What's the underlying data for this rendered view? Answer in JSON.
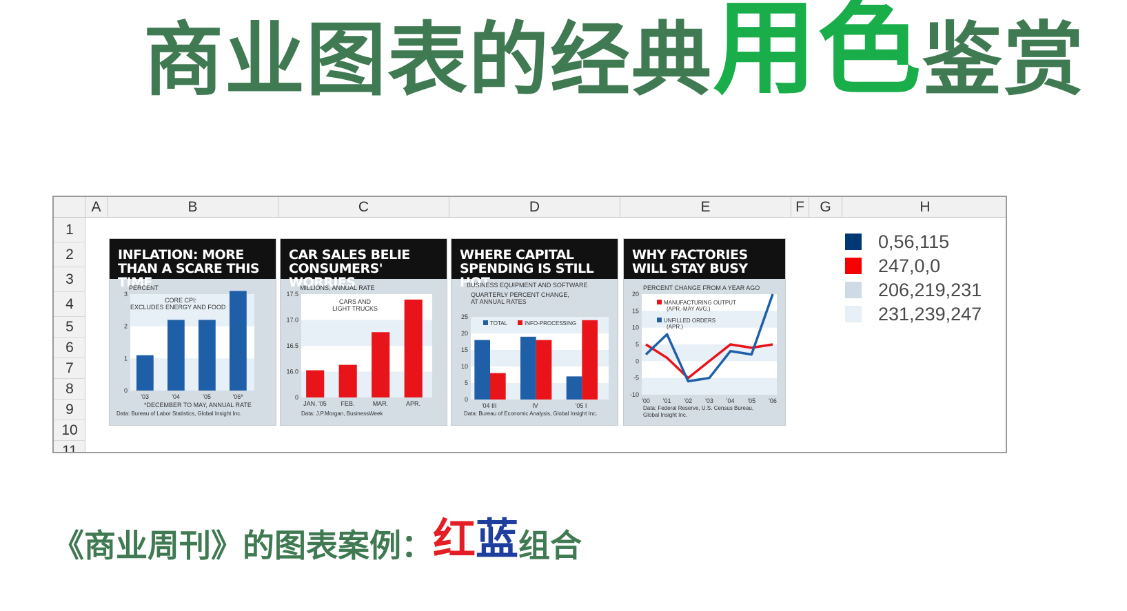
{
  "title": {
    "part1": "商业图表的经典",
    "part2": "用色",
    "part3": "鉴赏"
  },
  "sheet": {
    "columns": [
      "A",
      "B",
      "C",
      "D",
      "E",
      "F",
      "G",
      "H"
    ],
    "rows": [
      "1",
      "2",
      "3",
      "4",
      "5",
      "6",
      "7",
      "8",
      "9",
      "10",
      "11"
    ]
  },
  "charts": [
    {
      "headline": "INFLATION: MORE THAN A SCARE THIS TIME",
      "unit_label": "PERCENT",
      "note": "CORE CPI: EXCLUDES ENERGY AND FOOD",
      "footnote": "*DECEMBER TO MAY, ANNUAL RATE",
      "source": "Data: Bureau of Labor Statistics, Global Insight Inc.",
      "chart_data": {
        "type": "bar",
        "categories": [
          "'03",
          "'04",
          "'05",
          "'06*"
        ],
        "series": [
          {
            "values": [
              1.1,
              2.2,
              2.2,
              3.1
            ]
          }
        ],
        "ylim": [
          0,
          3
        ],
        "yticks": [
          "0",
          "1",
          "2",
          "3"
        ]
      }
    },
    {
      "headline": "CAR SALES BELIE CONSUMERS' WORRIES",
      "unit_label": "MILLIONS, ANNUAL RATE",
      "note": "CARS AND LIGHT TRUCKS",
      "source": "Data: J.P.Morgan, BusinessWeek",
      "chart_data": {
        "type": "bar",
        "categories": [
          "JAN. '05",
          "FEB.",
          "MAR.",
          "APR."
        ],
        "series": [
          {
            "values": [
              16.1,
              16.2,
              16.8,
              17.4
            ]
          }
        ],
        "ylim": [
          15.6,
          17.5
        ],
        "yticks": [
          "0",
          "16.0",
          "16.5",
          "17.0",
          "17.5"
        ]
      }
    },
    {
      "headline": "WHERE CAPITAL SPENDING IS STILL HOT",
      "subhead": "BUSINESS EQUIPMENT AND SOFTWARE",
      "unit_label": "QUARTERLY PERCENT CHANGE, AT ANNUAL RATES",
      "source": "Data: Bureau of Economic Analysis, Global Insight Inc.",
      "chart_data": {
        "type": "bar",
        "categories": [
          "'04 III",
          "IV",
          "'05 I"
        ],
        "series": [
          {
            "name": "TOTAL",
            "values": [
              18,
              19,
              7
            ]
          },
          {
            "name": "INFO-PROCESSING",
            "values": [
              8,
              18,
              24
            ]
          }
        ],
        "ylim": [
          0,
          25
        ],
        "yticks": [
          "0",
          "5",
          "10",
          "15",
          "20",
          "25"
        ]
      }
    },
    {
      "headline": "WHY FACTORIES WILL STAY BUSY",
      "unit_label": "PERCENT CHANGE FROM A YEAR AGO",
      "source": "Data: Federal Reserve, U.S. Census Bureau, Global Insight Inc.",
      "chart_data": {
        "type": "line",
        "x": [
          "'00",
          "'01",
          "'02",
          "'03",
          "'04",
          "'05",
          "'06"
        ],
        "series": [
          {
            "name": "MANUFACTURING OUTPUT (APR.-MAY AVG.)",
            "sub": "(APR.-MAY AVG.)",
            "values": [
              5,
              1,
              -5,
              0,
              5,
              4,
              5
            ]
          },
          {
            "name": "UNFILLED ORDERS (APR.)",
            "sub": "(APR.)",
            "values": [
              2,
              8,
              -6,
              -5,
              3,
              2,
              20
            ]
          }
        ],
        "ylim": [
          -10,
          20
        ],
        "yticks": [
          "-10",
          "-5",
          "0",
          "5",
          "10",
          "15",
          "20"
        ]
      }
    }
  ],
  "legend": [
    {
      "label": "0,56,115",
      "color": "#003873"
    },
    {
      "label": "247,0,0",
      "color": "#f70000"
    },
    {
      "label": "206,219,231",
      "color": "#cedbe7"
    },
    {
      "label": "231,239,247",
      "color": "#e7eff7"
    }
  ],
  "caption": {
    "part1": "《商业周刊》的图表案例：",
    "red": "红",
    "blue": "蓝",
    "part2": "组合"
  },
  "colors": {
    "blue": "#1f5fa8",
    "red": "#e8141a",
    "panel": "#d5dde4",
    "band": "#e7eff7"
  }
}
